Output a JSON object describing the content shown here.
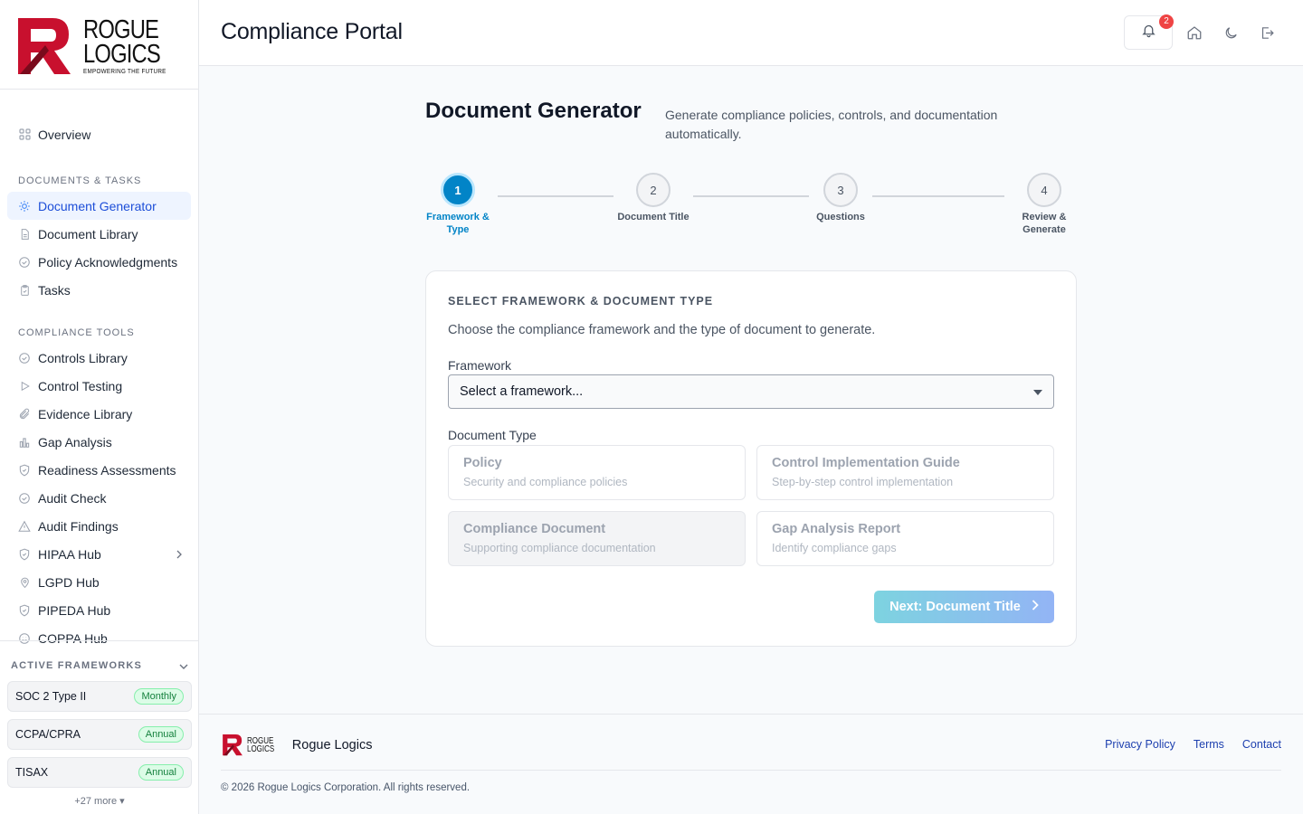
{
  "brand": {
    "logo_line1": "ROGUE",
    "logo_line2": "LOGICS",
    "tagline": "EMPOWERING THE FUTURE",
    "name": "Rogue Logics",
    "brand_color": "#c8102e"
  },
  "header": {
    "title": "Compliance Portal",
    "notification_count": "2"
  },
  "sidebar": {
    "overview": "Overview",
    "section_docs": "DOCUMENTS & TASKS",
    "docs_items": [
      {
        "label": "Document Generator",
        "icon": "lightbulb-icon",
        "active": true
      },
      {
        "label": "Document Library",
        "icon": "file-icon"
      },
      {
        "label": "Policy Acknowledgments",
        "icon": "check-circle-icon"
      },
      {
        "label": "Tasks",
        "icon": "clipboard-icon"
      }
    ],
    "section_tools": "COMPLIANCE TOOLS",
    "tools_items": [
      {
        "label": "Controls Library",
        "icon": "check-circle-icon"
      },
      {
        "label": "Control Testing",
        "icon": "play-icon"
      },
      {
        "label": "Evidence Library",
        "icon": "paperclip-icon"
      },
      {
        "label": "Gap Analysis",
        "icon": "bar-chart-icon"
      },
      {
        "label": "Readiness Assessments",
        "icon": "shield-check-icon"
      },
      {
        "label": "Audit Check",
        "icon": "check-circle-icon"
      },
      {
        "label": "Audit Findings",
        "icon": "warning-icon"
      },
      {
        "label": "HIPAA Hub",
        "icon": "shield-check-icon"
      },
      {
        "label": "LGPD Hub",
        "icon": "map-pin-icon"
      },
      {
        "label": "PIPEDA Hub",
        "icon": "shield-check-icon"
      },
      {
        "label": "COPPA Hub",
        "icon": "smile-icon"
      }
    ],
    "active_frameworks_label": "ACTIVE FRAMEWORKS",
    "frameworks": [
      {
        "name": "SOC 2 Type II",
        "cadence": "Monthly"
      },
      {
        "name": "CCPA/CPRA",
        "cadence": "Annual"
      },
      {
        "name": "TISAX",
        "cadence": "Annual"
      }
    ],
    "more_label": "+27 more ▾"
  },
  "page": {
    "title": "Document Generator",
    "subtitle": "Generate compliance policies, controls, and documentation automatically."
  },
  "stepper": {
    "steps": [
      {
        "num": "1",
        "label": "Framework & Type",
        "active": true
      },
      {
        "num": "2",
        "label": "Document Title"
      },
      {
        "num": "3",
        "label": "Questions"
      },
      {
        "num": "4",
        "label": "Review & Generate"
      }
    ]
  },
  "form": {
    "section_title": "SELECT FRAMEWORK & DOCUMENT TYPE",
    "description": "Choose the compliance framework and the type of document to generate.",
    "framework_label": "Framework",
    "framework_value": "Select a framework...",
    "doctype_label": "Document Type",
    "doc_types": [
      {
        "title": "Policy",
        "desc": "Security and compliance policies"
      },
      {
        "title": "Control Implementation Guide",
        "desc": "Step-by-step control implementation"
      },
      {
        "title": "Compliance Document",
        "desc": "Supporting compliance documentation"
      },
      {
        "title": "Gap Analysis Report",
        "desc": "Identify compliance gaps"
      }
    ],
    "next_label": "Next: Document Title"
  },
  "footer": {
    "links": [
      "Privacy Policy",
      "Terms",
      "Contact"
    ],
    "copyright": "© 2026 Rogue Logics Corporation. All rights reserved."
  }
}
